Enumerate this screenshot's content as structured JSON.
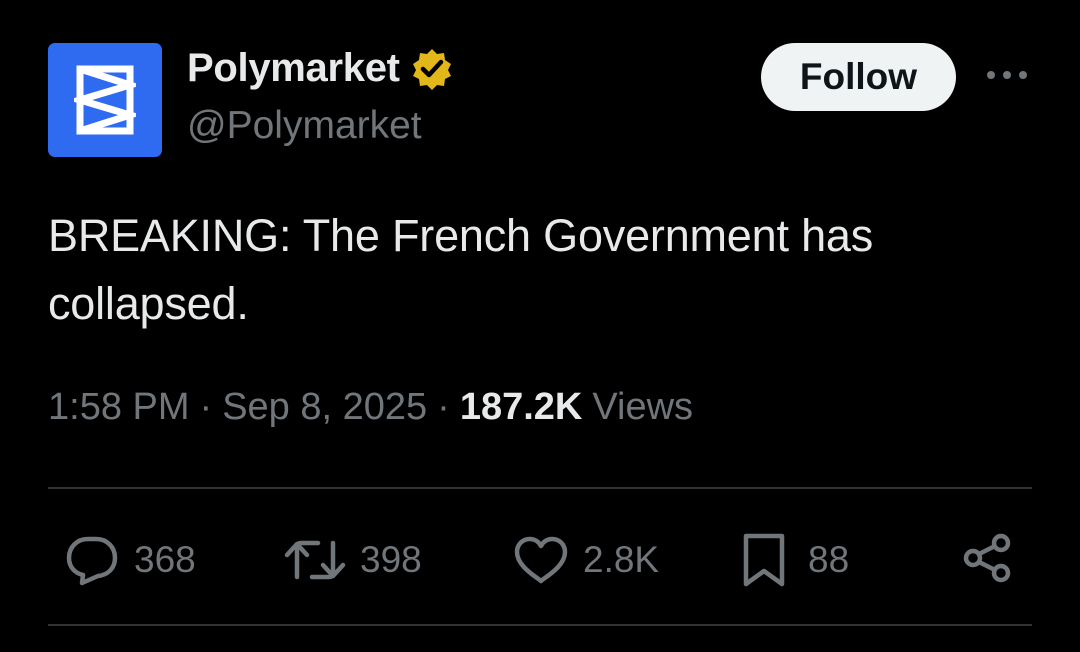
{
  "author": {
    "name": "Polymarket",
    "handle": "@Polymarket",
    "avatar_color": "#2f6bf0",
    "verified_color": "#e2b719"
  },
  "follow_label": "Follow",
  "tweet": {
    "text": "BREAKING: The French Government has collapsed."
  },
  "meta": {
    "time": "1:58 PM",
    "date": "Sep 8, 2025",
    "views_count": "187.2K",
    "views_label": "Views"
  },
  "actions": {
    "replies": "368",
    "reposts": "398",
    "likes": "2.8K",
    "bookmarks": "88"
  },
  "icons": [
    "reply-icon",
    "repost-icon",
    "like-icon",
    "bookmark-icon",
    "share-icon",
    "more-icon",
    "verified-badge-icon"
  ],
  "colors": {
    "background": "#000000",
    "text": "#e7e9ea",
    "secondary": "#71767b",
    "follow_bg": "#eff3f4"
  }
}
